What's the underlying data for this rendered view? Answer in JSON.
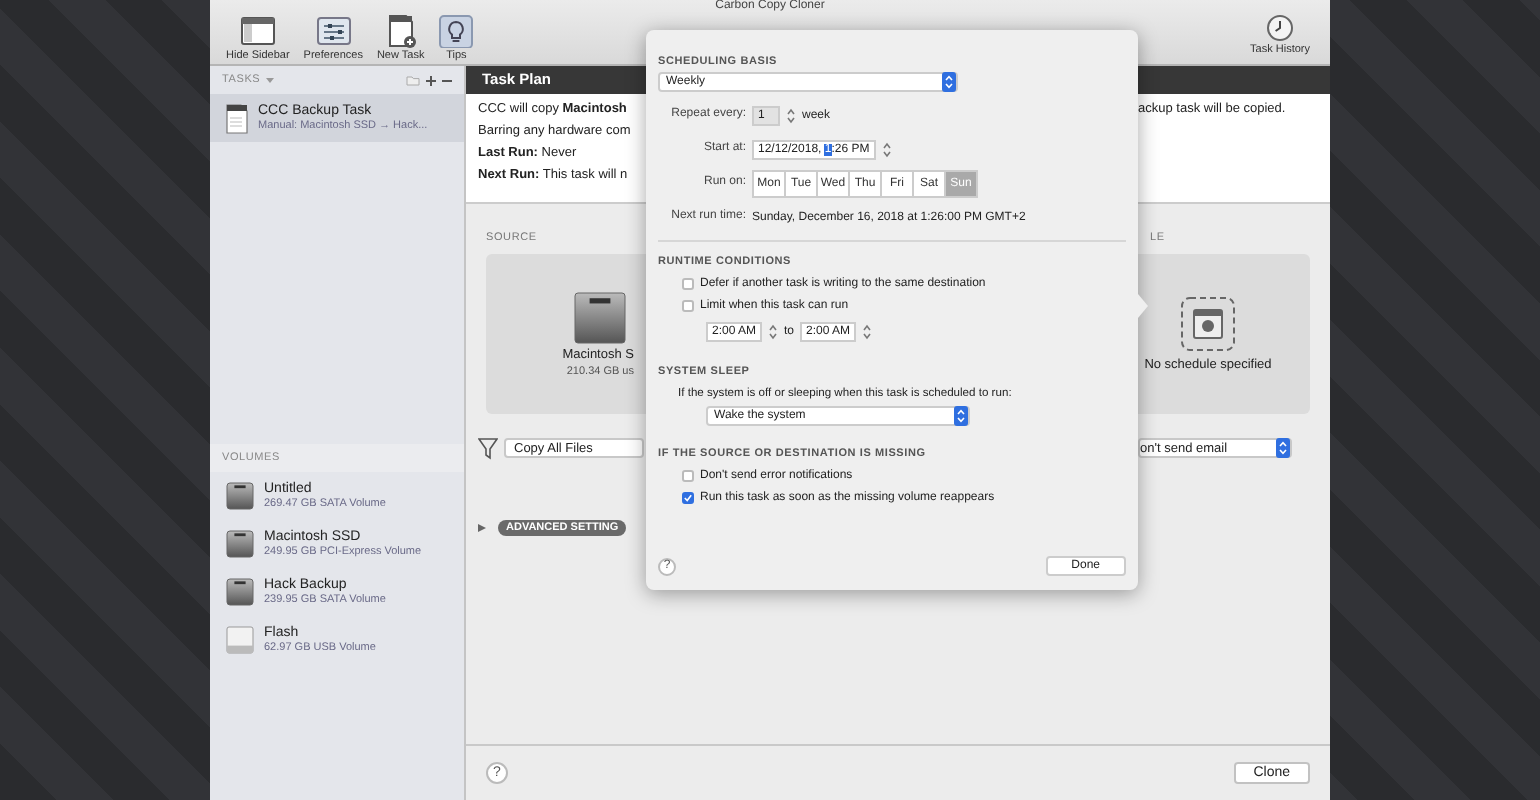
{
  "window": {
    "title": "Carbon Copy Cloner"
  },
  "toolbar": {
    "buttons": [
      {
        "label": "Hide Sidebar",
        "kind": "sidebar"
      },
      {
        "label": "Preferences",
        "kind": "prefs"
      },
      {
        "label": "New Task",
        "kind": "newtask"
      },
      {
        "label": "Tips",
        "kind": "tips"
      }
    ],
    "history": "Task History"
  },
  "sidebar": {
    "tasks_header": "TASKS",
    "tasks": [
      {
        "name": "CCC Backup Task",
        "detail": "Manual: Macintosh SSD → Hack...",
        "selected": true
      }
    ],
    "volumes_header": "VOLUMES",
    "volumes": [
      {
        "name": "Untitled",
        "detail": "269.47 GB SATA Volume",
        "kind": "disk"
      },
      {
        "name": "Macintosh SSD",
        "detail": "249.95 GB PCI-Express Volume",
        "kind": "disk"
      },
      {
        "name": "Hack Backup",
        "detail": "239.95 GB SATA Volume",
        "kind": "disk"
      },
      {
        "name": "Flash",
        "detail": "62.97 GB USB Volume",
        "kind": "usb"
      }
    ]
  },
  "task_plan": {
    "title": "Task Plan",
    "lines": [
      {
        "left": "CCC will copy **Macintosh**",
        "right": "ackup task will be copied."
      },
      {
        "left": "Barring any hardware com"
      },
      {
        "left": "**Last Run:** Never"
      },
      {
        "left": "**Next Run:** This task will n"
      }
    ]
  },
  "source": {
    "header": "SOURCE",
    "name": "Macintosh S",
    "detail": "210.34 GB us"
  },
  "schedule": {
    "header": "LE",
    "status": "No schedule specified"
  },
  "filter": {
    "value": "Copy All Files"
  },
  "email": {
    "value": "on't send email"
  },
  "advanced": {
    "label": "ADVANCED SETTING"
  },
  "footer": {
    "help": "?",
    "clone": "Clone"
  },
  "schedule_popover": {
    "scheduling_basis": {
      "header": "SCHEDULING BASIS",
      "value": "Weekly"
    },
    "repeat": {
      "label": "Repeat every:",
      "value": "1",
      "unit": "week"
    },
    "start": {
      "label": "Start at:",
      "date": "12/12/2018,",
      "hour": "1",
      "minute": ":26 PM"
    },
    "run_on": {
      "label": "Run on:",
      "days": [
        {
          "label": "Mon",
          "selected": false
        },
        {
          "label": "Tue",
          "selected": false
        },
        {
          "label": "Wed",
          "selected": false
        },
        {
          "label": "Thu",
          "selected": false
        },
        {
          "label": "Fri",
          "selected": false
        },
        {
          "label": "Sat",
          "selected": false
        },
        {
          "label": "Sun",
          "selected": true
        }
      ]
    },
    "next_run": {
      "label": "Next run time:",
      "value": "Sunday, December 16, 2018 at 1:26:00 PM GMT+2"
    },
    "runtime_conditions": {
      "header": "RUNTIME CONDITIONS",
      "options": [
        {
          "label": "Defer if another task is writing to the same destination",
          "checked": false
        },
        {
          "label": "Limit when this task can run",
          "checked": false
        }
      ],
      "from": "2:00 AM",
      "to_label": "to",
      "to": "2:00 AM"
    },
    "system_sleep": {
      "header": "SYSTEM SLEEP",
      "prompt": "If the system is off or sleeping when this task is scheduled to run:",
      "value": "Wake the system"
    },
    "missing": {
      "header": "IF THE SOURCE OR DESTINATION IS MISSING",
      "options": [
        {
          "label": "Don't send error notifications",
          "checked": false
        },
        {
          "label": "Run this task as soon as the missing volume reappears",
          "checked": true
        }
      ]
    },
    "help": "?",
    "done": "Done"
  }
}
